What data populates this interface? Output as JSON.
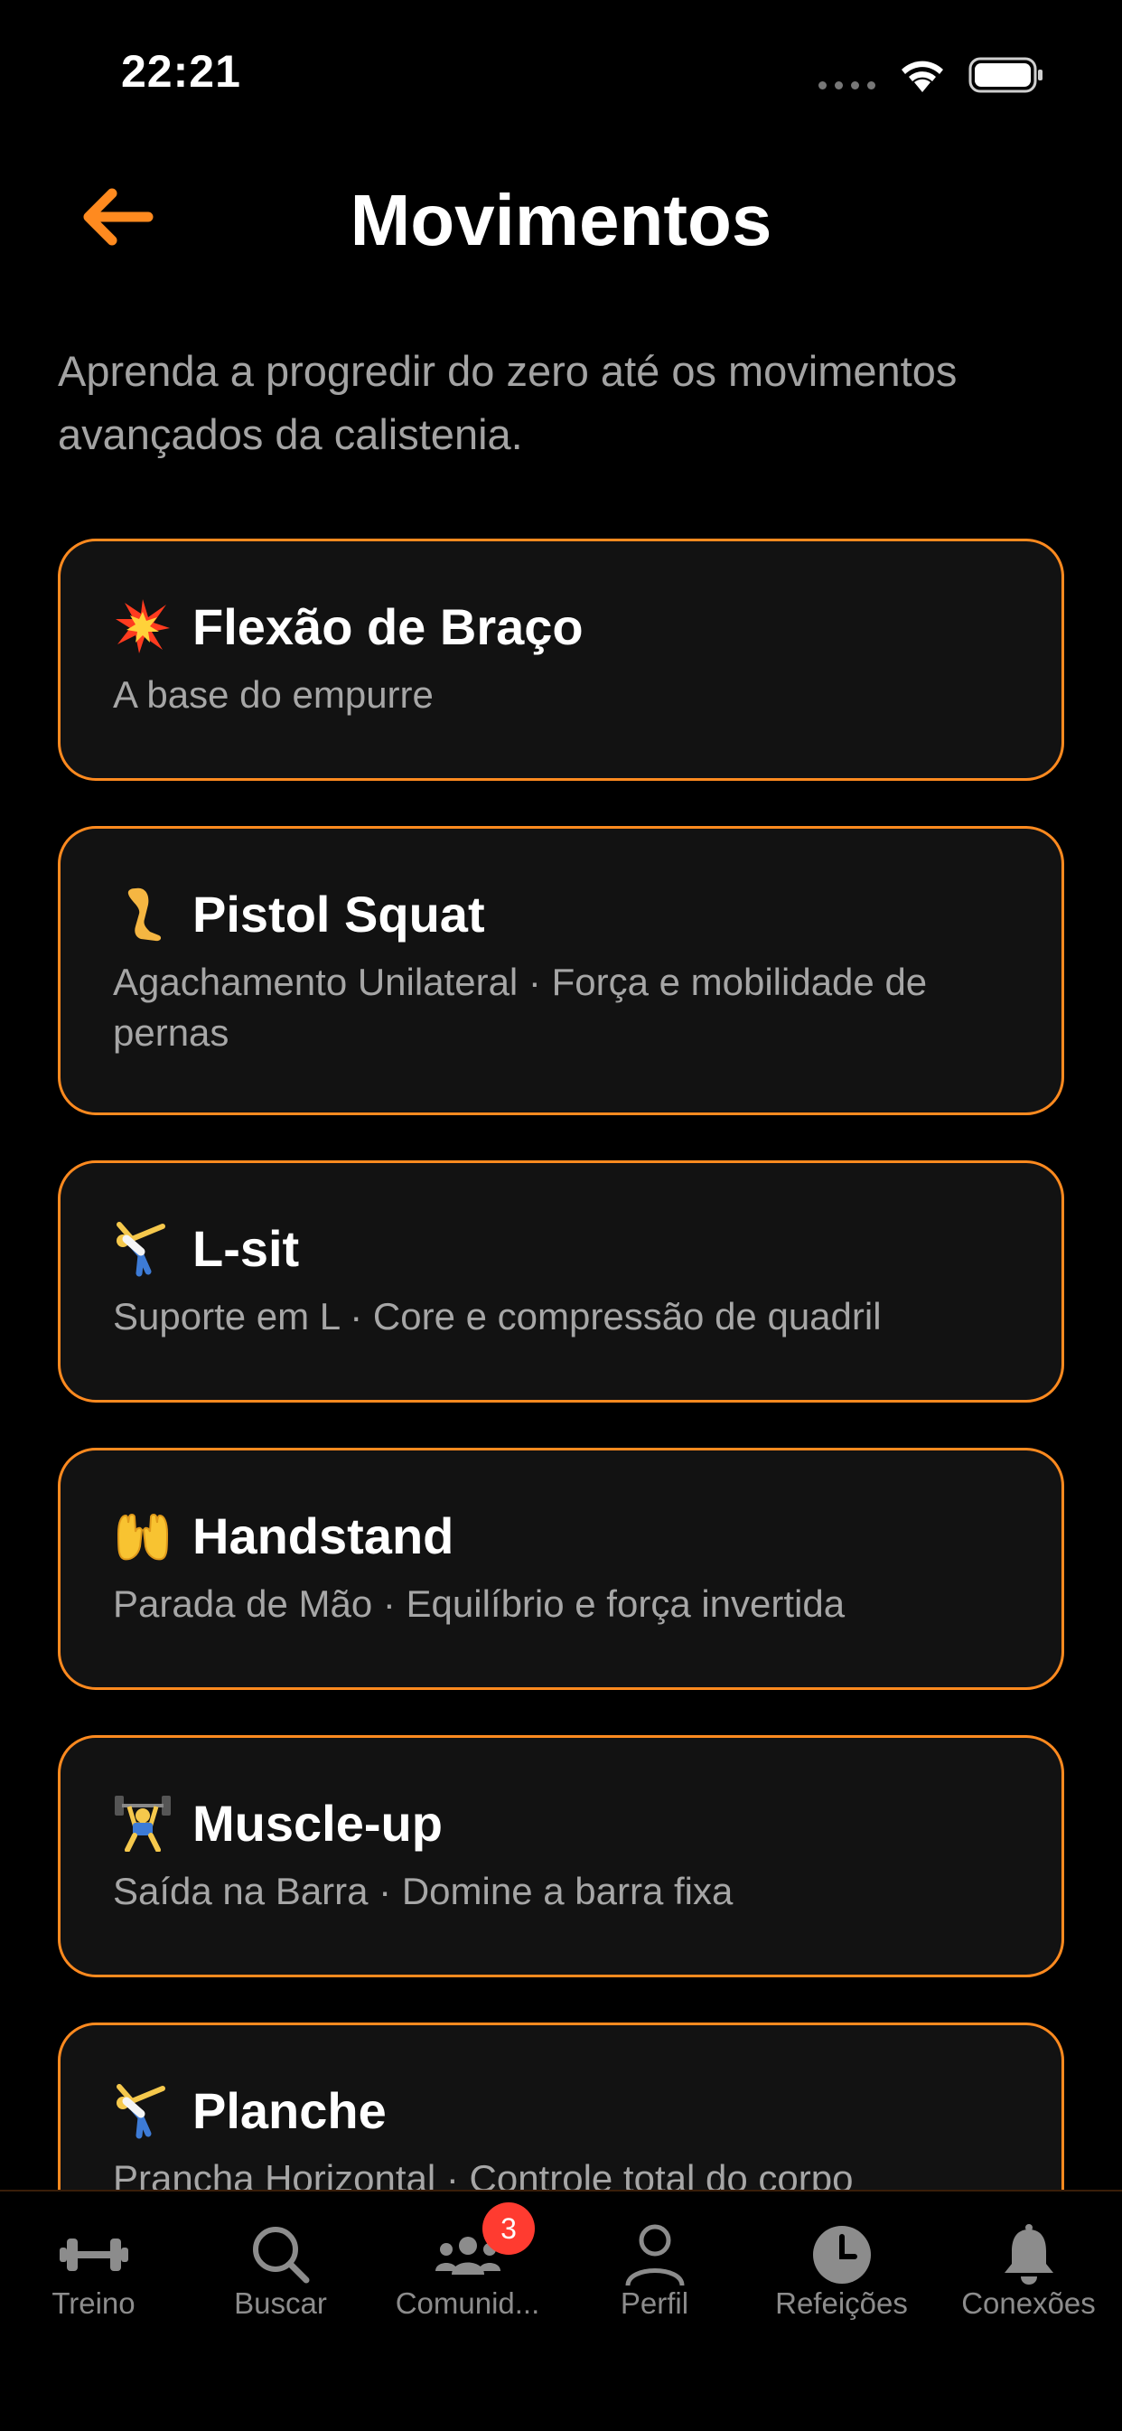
{
  "status_bar": {
    "time": "22:21"
  },
  "header": {
    "title": "Movimentos"
  },
  "intro": "Aprenda a progredir do zero até os movimentos avançados da calistenia.",
  "accent_color": "#ff8a1f",
  "cards": [
    {
      "icon": "collision-icon",
      "title": "Flexão de Braço",
      "subtitle": "A base do empurre"
    },
    {
      "icon": "leg-icon",
      "title": "Pistol Squat",
      "subtitle": "Agachamento Unilateral · Força e mobilidade de pernas"
    },
    {
      "icon": "cartwheel-icon",
      "title": "L-sit",
      "subtitle": "Suporte em L · Core e compressão de quadril"
    },
    {
      "icon": "palms-up-icon",
      "title": "Handstand",
      "subtitle": "Parada de Mão · Equilíbrio e força invertida"
    },
    {
      "icon": "weightlifter-icon",
      "title": "Muscle-up",
      "subtitle": "Saída na Barra · Domine a barra fixa"
    },
    {
      "icon": "cartwheel-icon",
      "title": "Planche",
      "subtitle": "Prancha Horizontal · Controle total do corpo"
    }
  ],
  "tab_bar": {
    "items": [
      {
        "label": "Treino",
        "icon": "dumbbell-icon"
      },
      {
        "label": "Buscar",
        "icon": "search-icon"
      },
      {
        "label": "Comunid...",
        "icon": "community-icon",
        "badge": "3"
      },
      {
        "label": "Perfil",
        "icon": "person-icon"
      },
      {
        "label": "Refeições",
        "icon": "clock-icon"
      },
      {
        "label": "Conexões",
        "icon": "bell-icon"
      }
    ]
  }
}
